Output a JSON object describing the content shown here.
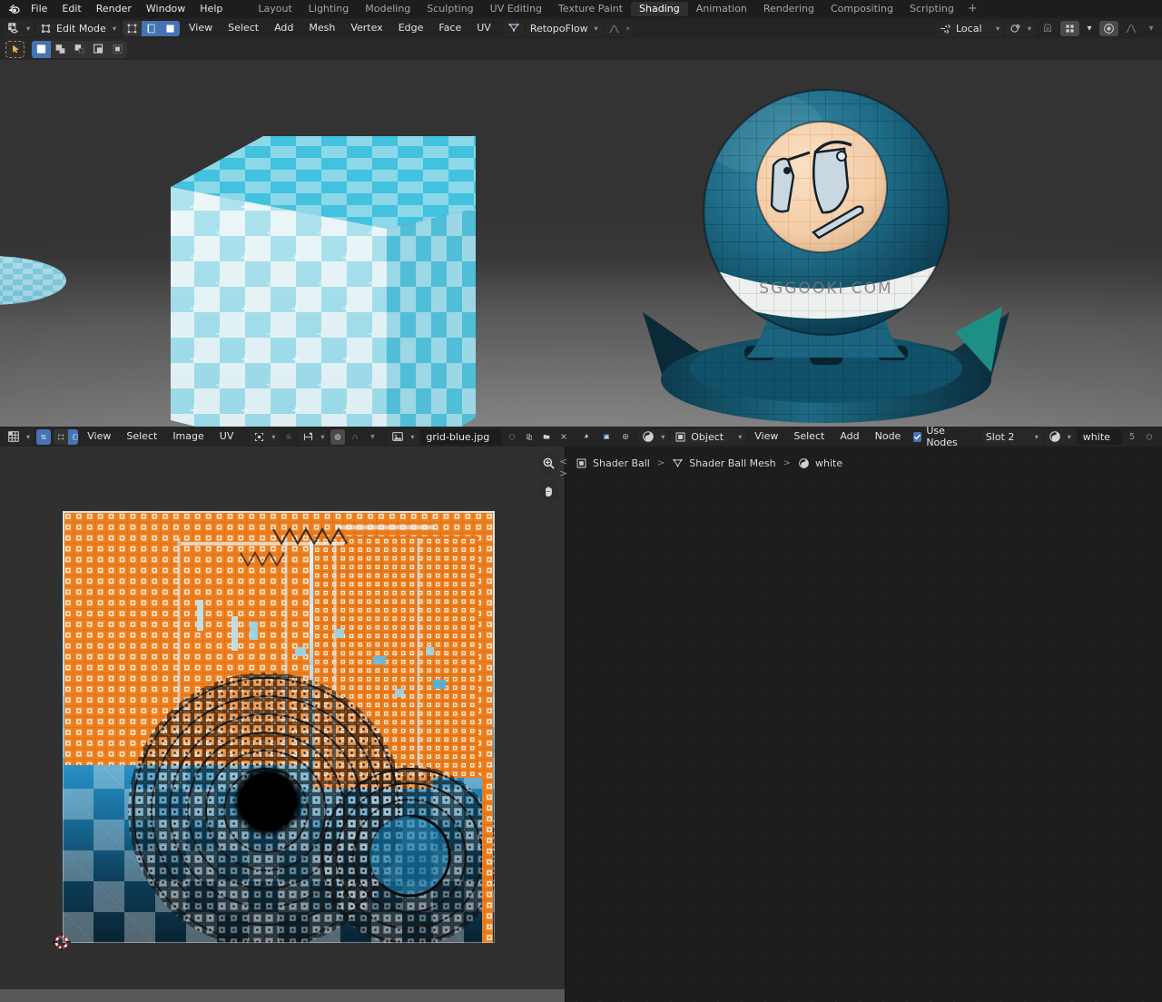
{
  "app": {
    "name": "Blender",
    "logo_icon": "blender-logo-icon"
  },
  "topbar": {
    "menus": [
      "File",
      "Edit",
      "Render",
      "Window",
      "Help"
    ],
    "workspaces": [
      {
        "label": "Layout",
        "active": false
      },
      {
        "label": "Lighting",
        "active": false
      },
      {
        "label": "Modeling",
        "active": false
      },
      {
        "label": "Sculpting",
        "active": false
      },
      {
        "label": "UV Editing",
        "active": false
      },
      {
        "label": "Texture Paint",
        "active": false
      },
      {
        "label": "Shading",
        "active": true
      },
      {
        "label": "Animation",
        "active": false
      },
      {
        "label": "Rendering",
        "active": false
      },
      {
        "label": "Compositing",
        "active": false
      },
      {
        "label": "Scripting",
        "active": false
      }
    ],
    "add_workspace_label": "+"
  },
  "viewport_header": {
    "editor_type_icon": "editor-type-3dview-icon",
    "mode": "Edit Mode",
    "mesh_select_modes": [
      {
        "name": "vertex-select-mode",
        "active": false
      },
      {
        "name": "edge-select-mode",
        "active": true
      },
      {
        "name": "face-select-mode",
        "active": true
      }
    ],
    "menus": [
      "View",
      "Select",
      "Add",
      "Mesh",
      "Vertex",
      "Edge",
      "Face",
      "UV"
    ],
    "addon": {
      "icon": "retopoflow-icon",
      "label": "RetopoFlow"
    },
    "transform_orientation": "Local",
    "orientation_icon": "transform-orientation-icon",
    "snap_icon": "magnet-icon",
    "snap_target_icon": "snap-target-icon",
    "proportional_icon": "proportional-editing-icon",
    "falloff_icon": "falloff-smooth-icon",
    "pivot_icon": "pivot-point-icon"
  },
  "viewport_toolbar": {
    "active_tool": "tweak-select-tool",
    "select_modes": [
      {
        "name": "select-set-mode",
        "active": true
      },
      {
        "name": "select-extend-mode",
        "active": false
      },
      {
        "name": "select-subtract-mode",
        "active": false
      },
      {
        "name": "select-invert-mode",
        "active": false
      },
      {
        "name": "select-intersect-mode",
        "active": false
      }
    ]
  },
  "viewport": {
    "objects": [
      {
        "name": "textured-cube",
        "material": "grid-blue checker"
      },
      {
        "name": "shader-ball",
        "material": "teal wireframe"
      },
      {
        "name": "ground-disc",
        "material": "blue checker"
      }
    ]
  },
  "uv_header": {
    "editor_type_icon": "editor-type-uv-icon",
    "uv_sync_selection": {
      "icon": "uv-sync-selection-icon",
      "active": true
    },
    "uv_select_modes": [
      {
        "name": "uv-vertex-select-mode",
        "active": false
      },
      {
        "name": "uv-edge-select-mode",
        "active": true
      },
      {
        "name": "uv-face-select-mode",
        "active": true
      }
    ],
    "menus": [
      "View",
      "Select",
      "Image",
      "UV"
    ],
    "pivot_icon": "pivot-point-icon",
    "snap_icon": "magnet-icon",
    "snap_target_icon": "snap-target-icon",
    "proportional_icon": "proportional-editing-icon",
    "falloff_icon": "falloff-smooth-icon",
    "browse_image_icon": "browse-image-icon",
    "image_name": "grid-blue.jpg",
    "image_placeholder": "Image",
    "fake_user_icon": "shield-icon",
    "new_image_icon": "copy-icon",
    "open_image_icon": "folder-icon",
    "unlink_icon": "x-icon",
    "pin_icon": "pin-icon",
    "display_channels_icon": "display-channels-icon",
    "gizmo_icon": "gizmo-icon"
  },
  "uv_editor": {
    "cursor_2d_icon": "cursor-2d-icon",
    "image_label": "grid-blue.jpg",
    "selection_color": "#f0801e",
    "unselected_color": "#000000"
  },
  "shader_header": {
    "editor_type_icon": "editor-type-shader-icon",
    "shader_type": "Object",
    "shader_type_icon": "object-shading-icon",
    "menus": [
      "View",
      "Select",
      "Add",
      "Node"
    ],
    "use_nodes": {
      "label": "Use Nodes",
      "checked": true
    },
    "slot": "Slot 2",
    "material_icon": "material-sphere-icon",
    "material_name": "white",
    "material_users": "5",
    "fake_user_icon": "shield-icon"
  },
  "shader_editor": {
    "tools": [
      {
        "name": "zoom-tool",
        "icon": "magnifier-icon"
      },
      {
        "name": "pan-tool",
        "icon": "hand-icon"
      }
    ],
    "nav_back_forward": "< >",
    "breadcrumb": [
      {
        "label": "Shader Ball",
        "icon": "object-icon"
      },
      {
        "label": "Shader Ball Mesh",
        "icon": "mesh-data-icon"
      },
      {
        "label": "white",
        "icon": "material-sphere-icon"
      }
    ],
    "breadcrumb_separator": ">"
  },
  "colors": {
    "accent_blue": "#4772b3",
    "header_bg": "#242424",
    "editor_bg": "#303030",
    "node_bg": "#1d1d1d",
    "uv_orange": "#f0801e",
    "cube_cyan": "#34bedc"
  }
}
